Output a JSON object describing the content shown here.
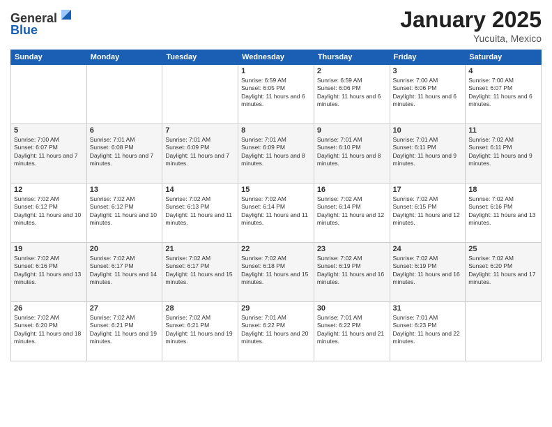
{
  "header": {
    "logo": {
      "line1": "General",
      "line2": "Blue"
    },
    "title": "January 2025",
    "location": "Yucuita, Mexico"
  },
  "weekdays": [
    "Sunday",
    "Monday",
    "Tuesday",
    "Wednesday",
    "Thursday",
    "Friday",
    "Saturday"
  ],
  "weeks": [
    [
      {
        "day": "",
        "sunrise": "",
        "sunset": "",
        "daylight": ""
      },
      {
        "day": "",
        "sunrise": "",
        "sunset": "",
        "daylight": ""
      },
      {
        "day": "",
        "sunrise": "",
        "sunset": "",
        "daylight": ""
      },
      {
        "day": "1",
        "sunrise": "Sunrise: 6:59 AM",
        "sunset": "Sunset: 6:05 PM",
        "daylight": "Daylight: 11 hours and 6 minutes."
      },
      {
        "day": "2",
        "sunrise": "Sunrise: 6:59 AM",
        "sunset": "Sunset: 6:06 PM",
        "daylight": "Daylight: 11 hours and 6 minutes."
      },
      {
        "day": "3",
        "sunrise": "Sunrise: 7:00 AM",
        "sunset": "Sunset: 6:06 PM",
        "daylight": "Daylight: 11 hours and 6 minutes."
      },
      {
        "day": "4",
        "sunrise": "Sunrise: 7:00 AM",
        "sunset": "Sunset: 6:07 PM",
        "daylight": "Daylight: 11 hours and 6 minutes."
      }
    ],
    [
      {
        "day": "5",
        "sunrise": "Sunrise: 7:00 AM",
        "sunset": "Sunset: 6:07 PM",
        "daylight": "Daylight: 11 hours and 7 minutes."
      },
      {
        "day": "6",
        "sunrise": "Sunrise: 7:01 AM",
        "sunset": "Sunset: 6:08 PM",
        "daylight": "Daylight: 11 hours and 7 minutes."
      },
      {
        "day": "7",
        "sunrise": "Sunrise: 7:01 AM",
        "sunset": "Sunset: 6:09 PM",
        "daylight": "Daylight: 11 hours and 7 minutes."
      },
      {
        "day": "8",
        "sunrise": "Sunrise: 7:01 AM",
        "sunset": "Sunset: 6:09 PM",
        "daylight": "Daylight: 11 hours and 8 minutes."
      },
      {
        "day": "9",
        "sunrise": "Sunrise: 7:01 AM",
        "sunset": "Sunset: 6:10 PM",
        "daylight": "Daylight: 11 hours and 8 minutes."
      },
      {
        "day": "10",
        "sunrise": "Sunrise: 7:01 AM",
        "sunset": "Sunset: 6:11 PM",
        "daylight": "Daylight: 11 hours and 9 minutes."
      },
      {
        "day": "11",
        "sunrise": "Sunrise: 7:02 AM",
        "sunset": "Sunset: 6:11 PM",
        "daylight": "Daylight: 11 hours and 9 minutes."
      }
    ],
    [
      {
        "day": "12",
        "sunrise": "Sunrise: 7:02 AM",
        "sunset": "Sunset: 6:12 PM",
        "daylight": "Daylight: 11 hours and 10 minutes."
      },
      {
        "day": "13",
        "sunrise": "Sunrise: 7:02 AM",
        "sunset": "Sunset: 6:12 PM",
        "daylight": "Daylight: 11 hours and 10 minutes."
      },
      {
        "day": "14",
        "sunrise": "Sunrise: 7:02 AM",
        "sunset": "Sunset: 6:13 PM",
        "daylight": "Daylight: 11 hours and 11 minutes."
      },
      {
        "day": "15",
        "sunrise": "Sunrise: 7:02 AM",
        "sunset": "Sunset: 6:14 PM",
        "daylight": "Daylight: 11 hours and 11 minutes."
      },
      {
        "day": "16",
        "sunrise": "Sunrise: 7:02 AM",
        "sunset": "Sunset: 6:14 PM",
        "daylight": "Daylight: 11 hours and 12 minutes."
      },
      {
        "day": "17",
        "sunrise": "Sunrise: 7:02 AM",
        "sunset": "Sunset: 6:15 PM",
        "daylight": "Daylight: 11 hours and 12 minutes."
      },
      {
        "day": "18",
        "sunrise": "Sunrise: 7:02 AM",
        "sunset": "Sunset: 6:16 PM",
        "daylight": "Daylight: 11 hours and 13 minutes."
      }
    ],
    [
      {
        "day": "19",
        "sunrise": "Sunrise: 7:02 AM",
        "sunset": "Sunset: 6:16 PM",
        "daylight": "Daylight: 11 hours and 13 minutes."
      },
      {
        "day": "20",
        "sunrise": "Sunrise: 7:02 AM",
        "sunset": "Sunset: 6:17 PM",
        "daylight": "Daylight: 11 hours and 14 minutes."
      },
      {
        "day": "21",
        "sunrise": "Sunrise: 7:02 AM",
        "sunset": "Sunset: 6:17 PM",
        "daylight": "Daylight: 11 hours and 15 minutes."
      },
      {
        "day": "22",
        "sunrise": "Sunrise: 7:02 AM",
        "sunset": "Sunset: 6:18 PM",
        "daylight": "Daylight: 11 hours and 15 minutes."
      },
      {
        "day": "23",
        "sunrise": "Sunrise: 7:02 AM",
        "sunset": "Sunset: 6:19 PM",
        "daylight": "Daylight: 11 hours and 16 minutes."
      },
      {
        "day": "24",
        "sunrise": "Sunrise: 7:02 AM",
        "sunset": "Sunset: 6:19 PM",
        "daylight": "Daylight: 11 hours and 16 minutes."
      },
      {
        "day": "25",
        "sunrise": "Sunrise: 7:02 AM",
        "sunset": "Sunset: 6:20 PM",
        "daylight": "Daylight: 11 hours and 17 minutes."
      }
    ],
    [
      {
        "day": "26",
        "sunrise": "Sunrise: 7:02 AM",
        "sunset": "Sunset: 6:20 PM",
        "daylight": "Daylight: 11 hours and 18 minutes."
      },
      {
        "day": "27",
        "sunrise": "Sunrise: 7:02 AM",
        "sunset": "Sunset: 6:21 PM",
        "daylight": "Daylight: 11 hours and 19 minutes."
      },
      {
        "day": "28",
        "sunrise": "Sunrise: 7:02 AM",
        "sunset": "Sunset: 6:21 PM",
        "daylight": "Daylight: 11 hours and 19 minutes."
      },
      {
        "day": "29",
        "sunrise": "Sunrise: 7:01 AM",
        "sunset": "Sunset: 6:22 PM",
        "daylight": "Daylight: 11 hours and 20 minutes."
      },
      {
        "day": "30",
        "sunrise": "Sunrise: 7:01 AM",
        "sunset": "Sunset: 6:22 PM",
        "daylight": "Daylight: 11 hours and 21 minutes."
      },
      {
        "day": "31",
        "sunrise": "Sunrise: 7:01 AM",
        "sunset": "Sunset: 6:23 PM",
        "daylight": "Daylight: 11 hours and 22 minutes."
      },
      {
        "day": "",
        "sunrise": "",
        "sunset": "",
        "daylight": ""
      }
    ]
  ]
}
